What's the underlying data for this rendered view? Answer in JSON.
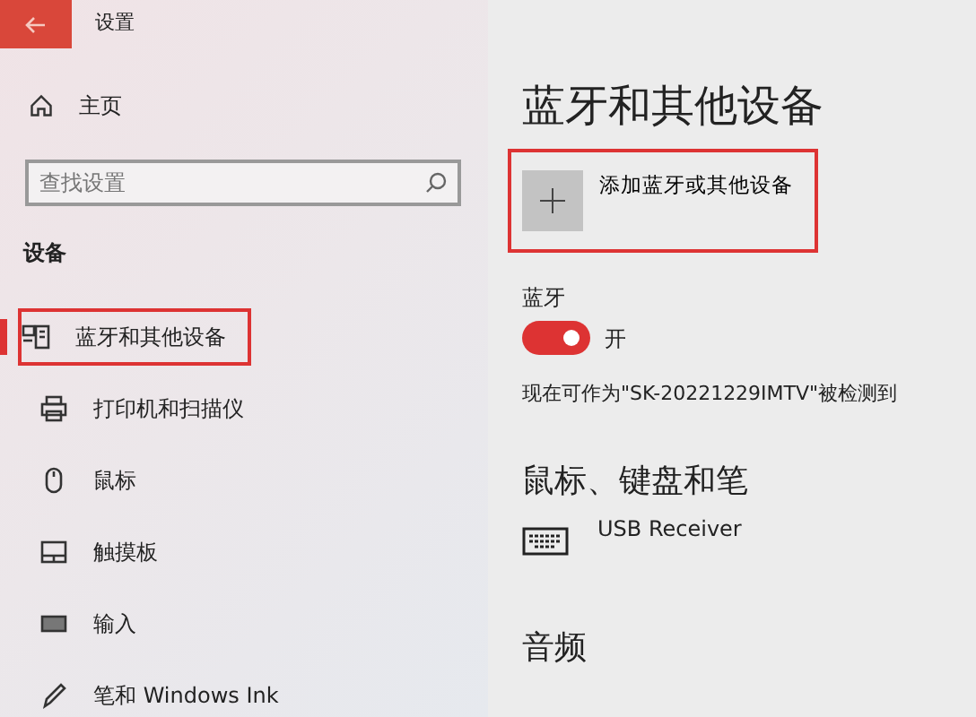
{
  "window": {
    "title": "设置"
  },
  "sidebar": {
    "home": "主页",
    "search": {
      "placeholder": "查找设置"
    },
    "section": "设备",
    "items": [
      {
        "label": "蓝牙和其他设备",
        "kind": "bluetooth",
        "selected": true
      },
      {
        "label": "打印机和扫描仪",
        "kind": "printer",
        "selected": false
      },
      {
        "label": "鼠标",
        "kind": "mouse",
        "selected": false
      },
      {
        "label": "触摸板",
        "kind": "touchpad",
        "selected": false
      },
      {
        "label": "输入",
        "kind": "keyboard",
        "selected": false
      },
      {
        "label": "笔和 Windows Ink",
        "kind": "pen",
        "selected": false
      }
    ]
  },
  "main": {
    "title": "蓝牙和其他设备",
    "add_device": {
      "label": "添加蓝牙或其他设备",
      "highlighted": true
    },
    "bluetooth": {
      "label": "蓝牙",
      "on": true,
      "state_label": "开"
    },
    "discoverable": "现在可作为\"SK-20221229IMTV\"被检测到",
    "section": "鼠标、键盘和笔",
    "devices": [
      {
        "name": "USB Receiver"
      }
    ],
    "section_2": "音频"
  }
}
